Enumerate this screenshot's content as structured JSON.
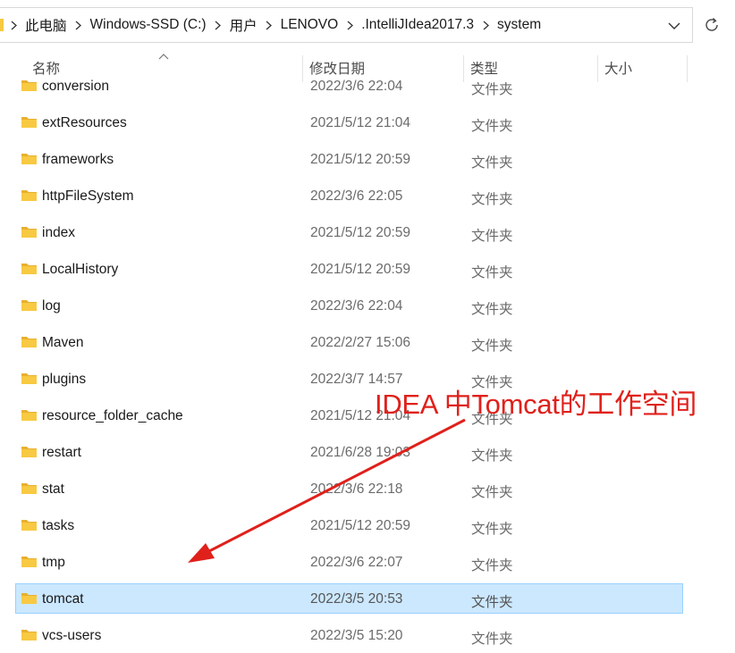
{
  "address_bar": {
    "crumbs": [
      "此电脑",
      "Windows-SSD (C:)",
      "用户",
      "LENOVO",
      ".IntelliJIdea2017.3",
      "system"
    ]
  },
  "columns": {
    "name": "名称",
    "modified": "修改日期",
    "type": "类型",
    "size": "大小"
  },
  "files": [
    {
      "name": "conversion",
      "modified": "2022/3/6 22:04",
      "type": "文件夹",
      "selected": false
    },
    {
      "name": "extResources",
      "modified": "2021/5/12 21:04",
      "type": "文件夹",
      "selected": false
    },
    {
      "name": "frameworks",
      "modified": "2021/5/12 20:59",
      "type": "文件夹",
      "selected": false
    },
    {
      "name": "httpFileSystem",
      "modified": "2022/3/6 22:05",
      "type": "文件夹",
      "selected": false
    },
    {
      "name": "index",
      "modified": "2021/5/12 20:59",
      "type": "文件夹",
      "selected": false
    },
    {
      "name": "LocalHistory",
      "modified": "2021/5/12 20:59",
      "type": "文件夹",
      "selected": false
    },
    {
      "name": "log",
      "modified": "2022/3/6 22:04",
      "type": "文件夹",
      "selected": false
    },
    {
      "name": "Maven",
      "modified": "2022/2/27 15:06",
      "type": "文件夹",
      "selected": false
    },
    {
      "name": "plugins",
      "modified": "2022/3/7 14:57",
      "type": "文件夹",
      "selected": false
    },
    {
      "name": "resource_folder_cache",
      "modified": "2021/5/12 21:04",
      "type": "文件夹",
      "selected": false
    },
    {
      "name": "restart",
      "modified": "2021/6/28 19:03",
      "type": "文件夹",
      "selected": false
    },
    {
      "name": "stat",
      "modified": "2022/3/6 22:18",
      "type": "文件夹",
      "selected": false
    },
    {
      "name": "tasks",
      "modified": "2021/5/12 20:59",
      "type": "文件夹",
      "selected": false
    },
    {
      "name": "tmp",
      "modified": "2022/3/6 22:07",
      "type": "文件夹",
      "selected": false
    },
    {
      "name": "tomcat",
      "modified": "2022/3/5 20:53",
      "type": "文件夹",
      "selected": true
    },
    {
      "name": "vcs-users",
      "modified": "2022/3/5 15:20",
      "type": "文件夹",
      "selected": false
    }
  ],
  "annotation": {
    "text": "IDEA 中Tomcat的工作空间",
    "color": "#e0201b"
  },
  "colors": {
    "selection_bg": "#cce8ff",
    "selection_border": "#99d1ff",
    "folder_yellow": "#f8c942"
  },
  "icons": {
    "address_root": "folder-icon",
    "crumb_separator": "chevron-right-icon",
    "dropdown": "chevron-down-icon",
    "refresh": "refresh-icon",
    "sort": "sort-up-icon",
    "row": "folder-icon"
  }
}
